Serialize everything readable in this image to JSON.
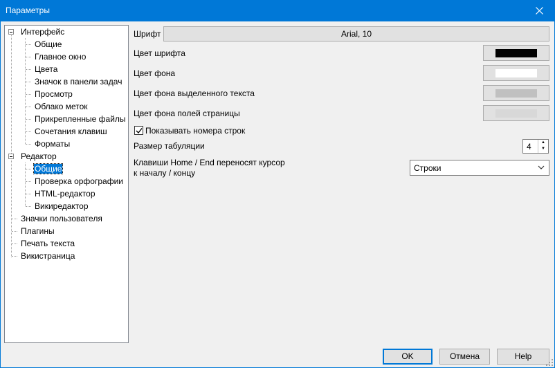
{
  "window": {
    "title": "Параметры"
  },
  "tree": {
    "interface": "Интерфейс",
    "interface_children": [
      "Общие",
      "Главное окно",
      "Цвета",
      "Значок в панели задач",
      "Просмотр",
      "Облако меток",
      "Прикрепленные файлы",
      "Сочетания клавиш",
      "Форматы"
    ],
    "editor": "Редактор",
    "editor_children": [
      "Общие",
      "Проверка орфографии",
      "HTML-редактор",
      "Викиредактор"
    ],
    "roots": [
      "Значки пользователя",
      "Плагины",
      "Печать текста",
      "Викистраница"
    ],
    "selected": "Редактор / Общие"
  },
  "settings": {
    "font_label": "Шрифт",
    "font_value": "Arial, 10",
    "font_color_label": "Цвет шрифта",
    "bg_color_label": "Цвет фона",
    "sel_bg_color_label": "Цвет фона выделенного текста",
    "margin_bg_color_label": "Цвет фона полей страницы",
    "show_line_numbers_label": "Показывать номера строк",
    "show_line_numbers_checked": true,
    "tab_size_label": "Размер табуляции",
    "tab_size_value": "4",
    "home_end_label_line1": "Клавиши Home / End переносят курсор",
    "home_end_label_line2": "к началу / концу",
    "home_end_value": "Строки"
  },
  "colors": {
    "font_color": "#000000",
    "bg_color": "#ffffff",
    "sel_bg_color": "#c0c0c0",
    "margin_bg_color": "#d8d8d8",
    "accent": "#0078d7"
  },
  "buttons": {
    "ok": "OK",
    "cancel": "Отмена",
    "help": "Help"
  }
}
